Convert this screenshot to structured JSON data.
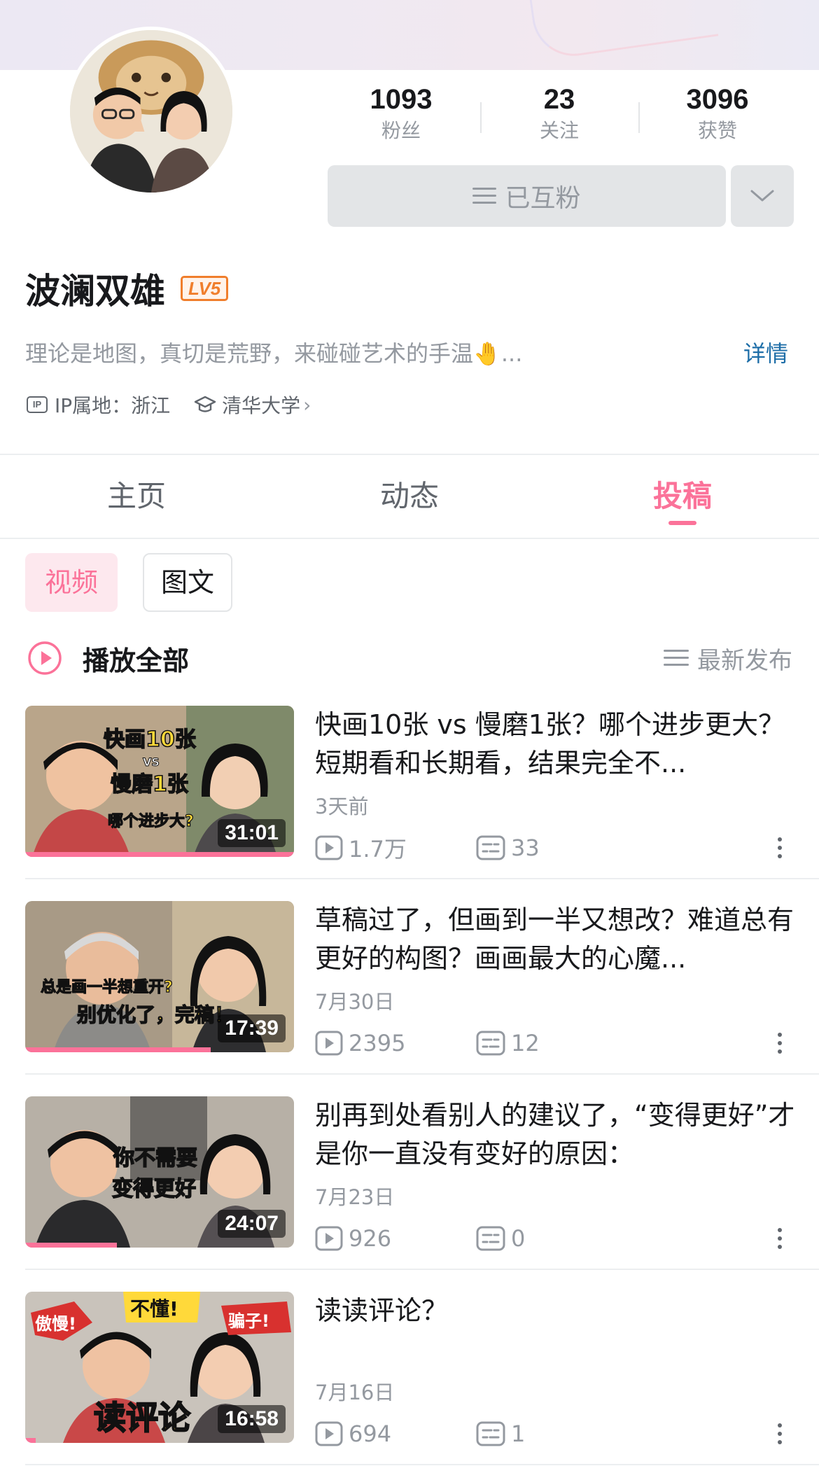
{
  "profile": {
    "name": "波澜双雄",
    "level": "LV5",
    "bio": "理论是地图，真切是荒野，来碰碰艺术的手温🤚...",
    "detail_label": "详情",
    "ip_badge": "IP",
    "ip_location": "IP属地：浙江",
    "school": "清华大学",
    "school_chevron": "›"
  },
  "stats": [
    {
      "value": "1093",
      "label": "粉丝"
    },
    {
      "value": "23",
      "label": "关注"
    },
    {
      "value": "3096",
      "label": "获赞"
    }
  ],
  "follow_button": {
    "label": "已互粉"
  },
  "tabs": [
    {
      "label": "主页",
      "active": false
    },
    {
      "label": "动态",
      "active": false
    },
    {
      "label": "投稿",
      "active": true
    }
  ],
  "filters": [
    {
      "label": "视频",
      "active": true
    },
    {
      "label": "图文",
      "active": false
    }
  ],
  "play_all_label": "播放全部",
  "sort_label": "最新发布",
  "videos": [
    {
      "title": "快画10张 vs 慢磨1张？哪个进步更大？短期看和长期看，结果完全不...",
      "date": "3天前",
      "views": "1.7万",
      "comments": "33",
      "duration": "31:01",
      "progress": 1.0,
      "thumb_text": [
        "快画10张",
        "VS",
        "慢磨1张",
        "哪个进步大?"
      ]
    },
    {
      "title": "草稿过了，但画到一半又想改？难道总有更好的构图？画画最大的心魔...",
      "date": "7月30日",
      "views": "2395",
      "comments": "12",
      "duration": "17:39",
      "progress": 0.69,
      "thumb_text": [
        "总是画一半想重开?",
        "别优化了，完稿！"
      ]
    },
    {
      "title": "别再到处看别人的建议了，“变得更好”才是你一直没有变好的原因：",
      "date": "7月23日",
      "views": "926",
      "comments": "0",
      "duration": "24:07",
      "progress": 0.34,
      "thumb_text": [
        "你不需要",
        "变得更好"
      ]
    },
    {
      "title": "读读评论？",
      "date": "7月16日",
      "views": "694",
      "comments": "1",
      "duration": "16:58",
      "progress": 0.04,
      "thumb_text": [
        "傲慢!",
        "不懂!",
        "骗子!",
        "读评论"
      ]
    }
  ],
  "colors": {
    "accent": "#fb7299",
    "link": "#1e6ea8",
    "level": "#f07e2c",
    "muted": "#9499a0"
  }
}
